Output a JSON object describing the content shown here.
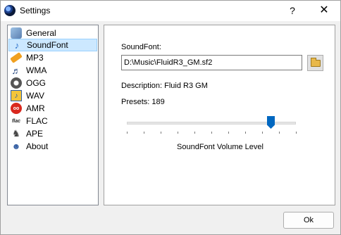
{
  "window": {
    "title": "Settings",
    "help_label": "?",
    "close_label": "✕"
  },
  "sidebar": {
    "items": [
      {
        "label": "General",
        "icon": "general-icon"
      },
      {
        "label": "SoundFont",
        "icon": "soundfont-icon",
        "selected": true
      },
      {
        "label": "MP3",
        "icon": "mp3-icon"
      },
      {
        "label": "WMA",
        "icon": "wma-icon"
      },
      {
        "label": "OGG",
        "icon": "ogg-icon"
      },
      {
        "label": "WAV",
        "icon": "wav-icon"
      },
      {
        "label": "AMR",
        "icon": "amr-icon"
      },
      {
        "label": "FLAC",
        "icon": "flac-icon"
      },
      {
        "label": "APE",
        "icon": "ape-icon"
      },
      {
        "label": "About",
        "icon": "about-icon"
      }
    ]
  },
  "soundfont": {
    "label": "SoundFont:",
    "path": "D:\\Music\\FluidR3_GM.sf2",
    "description": "Description: Fluid R3 GM",
    "presets": "Presets: 189",
    "volume_caption": "SoundFont Volume Level",
    "volume_level": 0.85
  },
  "footer": {
    "ok_label": "Ok"
  },
  "colors": {
    "selection_bg": "#cce8ff",
    "slider_thumb": "#0067c0"
  }
}
